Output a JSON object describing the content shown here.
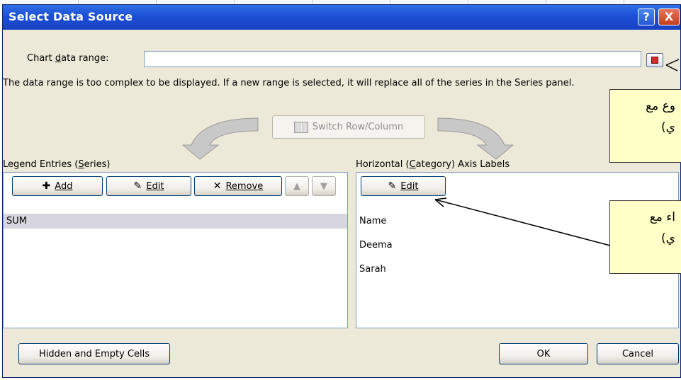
{
  "window": {
    "title": "Select Data Source",
    "help_label": "?",
    "close_label": "X"
  },
  "chart_range": {
    "label": "Chart data range:",
    "value": "",
    "message": "The data range is too complex to be displayed. If a new range is selected, it will replace all of the series in the Series panel."
  },
  "switch_button": {
    "label": "Switch Row/Column"
  },
  "legend": {
    "heading": "Legend Entries (Series)",
    "add_label": "Add",
    "edit_label": "Edit",
    "remove_label": "Remove",
    "up_label": "▲",
    "down_label": "▼",
    "series": [
      "SUM"
    ]
  },
  "axis": {
    "heading": "Horizontal (Category) Axis Labels",
    "edit_label": "Edit",
    "labels": [
      "Name",
      "Deema",
      "Sarah"
    ]
  },
  "footer": {
    "hidden_cells_label": "Hidden and Empty Cells",
    "ok_label": "OK",
    "cancel_label": "Cancel"
  },
  "callouts": [
    {
      "line1": "وع مع",
      "line2": "ي)"
    },
    {
      "line1": "اء مع",
      "line2": "ي)"
    }
  ],
  "colors": {
    "titlebar": "#1c4fd4",
    "dialog_bg": "#ece9d8",
    "callout_bg": "#ffffc8",
    "selected_row": "#d7d6de"
  }
}
